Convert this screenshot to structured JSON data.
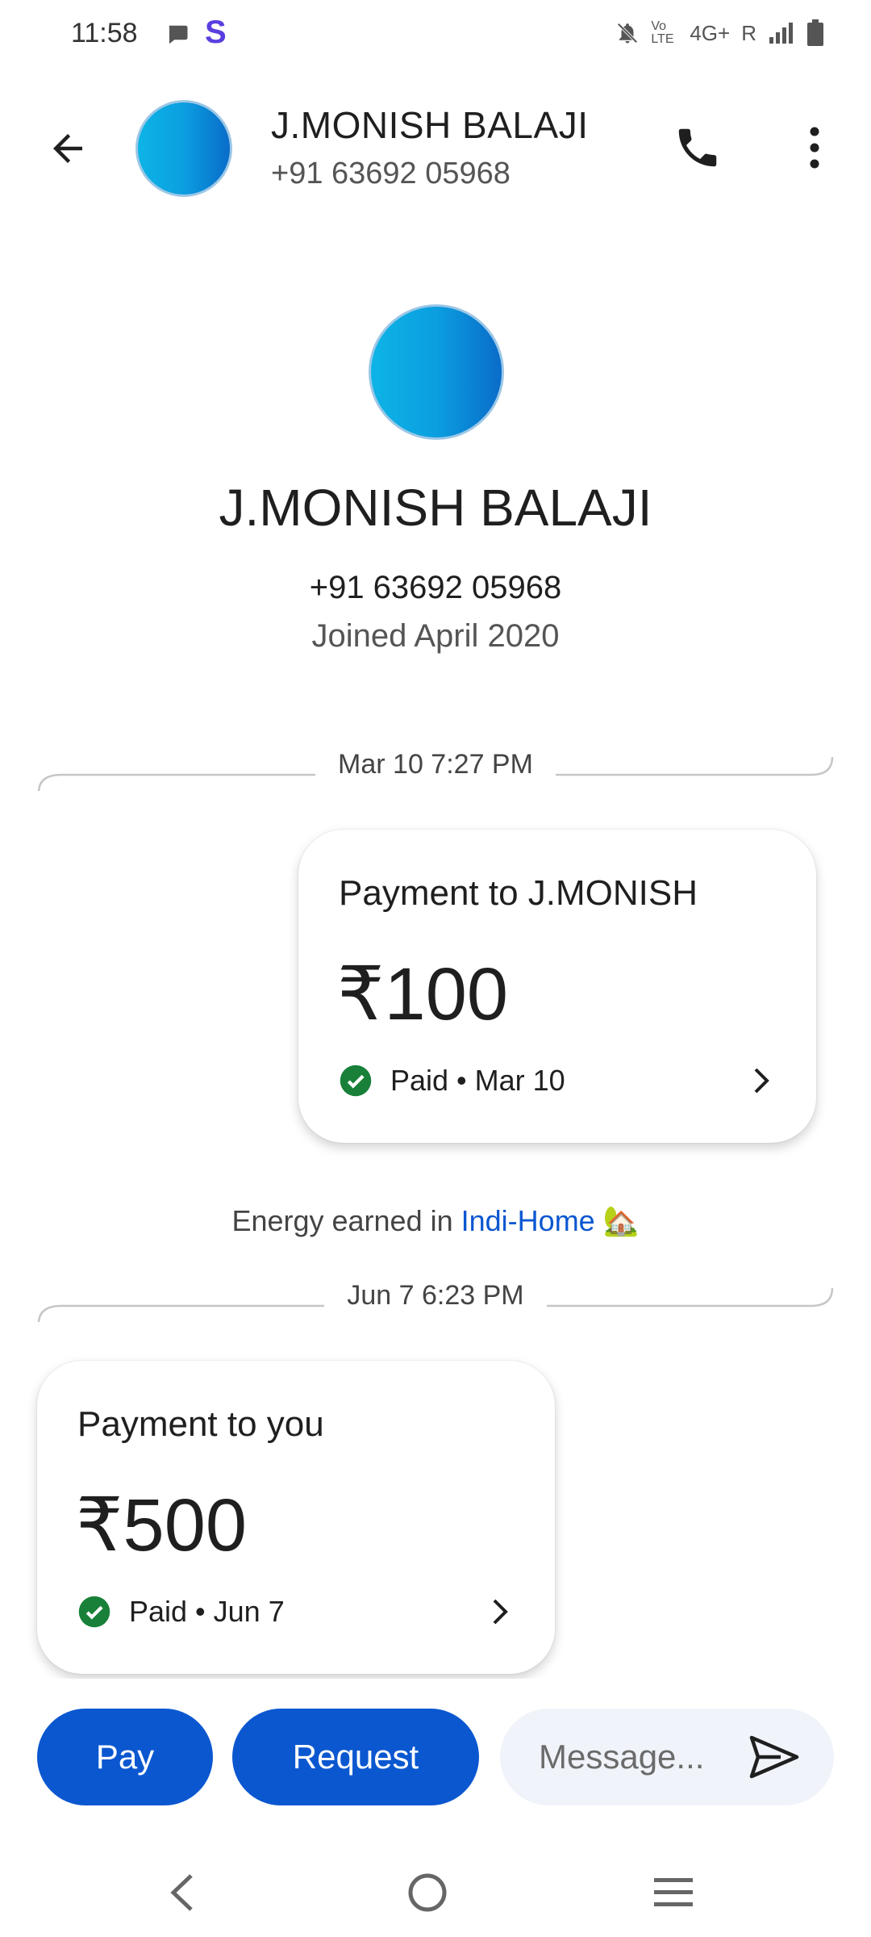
{
  "status_bar": {
    "time": "11:58",
    "network": "4G+",
    "roaming": "R",
    "volte": "Vo LTE"
  },
  "header": {
    "name": "J.MONISH BALAJI",
    "phone": "+91 63692 05968"
  },
  "profile": {
    "name": "J.MONISH BALAJI",
    "phone": "+91 63692 05968",
    "joined": "Joined April 2020"
  },
  "conversation": [
    {
      "date": "Mar 10 7:27 PM",
      "title": "Payment to J.MONISH",
      "amount": "₹100",
      "status": "Paid • Mar 10"
    },
    {
      "date": "Jun 7 6:23 PM",
      "title": "Payment to you",
      "amount": "₹500",
      "status": "Paid • Jun 7"
    }
  ],
  "energy": {
    "prefix": "Energy earned in",
    "link": "Indi-Home",
    "emoji": "🏡"
  },
  "composer": {
    "pay_label": "Pay",
    "request_label": "Request",
    "message_placeholder": "Message..."
  },
  "colors": {
    "primary": "#0b57d0",
    "success": "#188038",
    "avatar_gradient_start": "#0db4e6",
    "avatar_gradient_end": "#0a6cc9"
  }
}
